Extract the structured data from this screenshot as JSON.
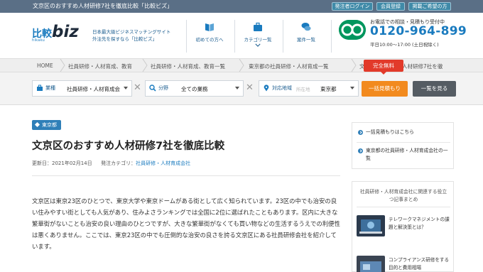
{
  "topbar": {
    "title": "文京区のおすすめ人材研修7社を徹底比較「比較ビズ」",
    "buttons": [
      "発注者ログイン",
      "会員登録",
      "掲載ご希望の方"
    ]
  },
  "header": {
    "logo_main": "比較",
    "logo_biz": "biz",
    "logo_sub": "hikaku",
    "tagline_1": "日本最大級ビジネスマッチングサイト",
    "tagline_2": "外注先を探すなら「比較ビズ」",
    "nav": [
      {
        "label": "初めての方へ",
        "icon": "book-icon"
      },
      {
        "label": "カテゴリ一覧",
        "icon": "briefcase-icon"
      },
      {
        "label": "案件一覧",
        "icon": "chat-icon"
      }
    ],
    "phone_label": "お電話での相談・見積もり受付中",
    "phone_number": "0120-964-899",
    "phone_hours": "平日10:00～17:00 (土日祝除く)"
  },
  "breadcrumb": [
    "HOME",
    "社員研修・人材育成、教育",
    "社員研修・人材育成、教育一覧",
    "東京都の社員研修・人材育成一覧",
    "文京区のおすすめ人材研修7社を徹"
  ],
  "search": {
    "industry_label": "業種",
    "industry_value": "社員研修・人材育成会",
    "field_label": "分野",
    "field_value": "全ての業務",
    "area_label": "対応地域",
    "area_placeholder": "所在地",
    "area_value": "東京都",
    "free_badge": "完全無料",
    "quote_button": "一括見積もり",
    "list_button": "一覧を見る"
  },
  "article": {
    "tag": "東京都",
    "title": "文京区のおすすめ人材研修7社を徹底比較",
    "updated_label": "更新日：2021年02月14日",
    "category_label": "発注カテゴリ：",
    "category_value": "社員研修・人材育成会社",
    "body": "文京区は東京23区のひとつで、東京大学や東京ドームがある街として広く知られています。23区の中でも治安の良い住みやすい街としても人気があり、住みよさランキングでは全国に2位に選ばれたこともあります。区内に大きな繁華街がないことも治安の良い理由のひとつですが、大きな繁華街がなくても買い物などの生活するうえでの利便性は悪くありません。ここでは、東京23区の中でも圧倒的な治安の良さを誇る文京区にある社員研修会社を紹介しています。"
  },
  "sidebar": {
    "links": [
      "一括見積もりはこちら",
      "東京都の社員研修・人材育成会社の一覧"
    ],
    "related_head": "社員研修・人材育成会社に関連する役立つ記事まとめ",
    "articles": [
      {
        "title": "テレワークマネジメントの課題と解決策とは？"
      },
      {
        "title": "コンプライアンス研修をする目的と費用相場"
      }
    ]
  },
  "colors": {
    "brand_blue": "#1a7bbf",
    "cta_orange": "#f28a1e",
    "free_red": "#e23a2a",
    "phone_green": "#00965e"
  }
}
